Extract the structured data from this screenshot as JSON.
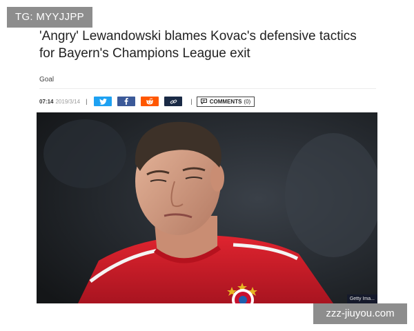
{
  "overlay": {
    "tg_label": "TG: MYYJJPP",
    "watermark": "zzz-jiuyou.com"
  },
  "article": {
    "headline_line1": "'Angry' Lewandowski blames Kovac's defensive tactics",
    "headline_line2": "for Bayern's Champions League exit",
    "source": "Goal",
    "time": "07:14",
    "date": "2019/3/14",
    "separator": "|",
    "comments_label": "COMMENTS",
    "comments_count": "(0)",
    "photo_credit": "Getty Ima..."
  },
  "share_buttons": [
    {
      "name": "twitter",
      "icon": "twitter-icon",
      "color": "#1da1f2"
    },
    {
      "name": "facebook",
      "icon": "facebook-icon",
      "color": "#3b5998"
    },
    {
      "name": "reddit",
      "icon": "reddit-icon",
      "color": "#ff5700"
    },
    {
      "name": "link",
      "icon": "link-icon",
      "color": "#1a2a45"
    }
  ],
  "colors": {
    "jersey_red": "#d21a2b",
    "text": "#222222",
    "overlay_grey": "#8d8d8d"
  }
}
